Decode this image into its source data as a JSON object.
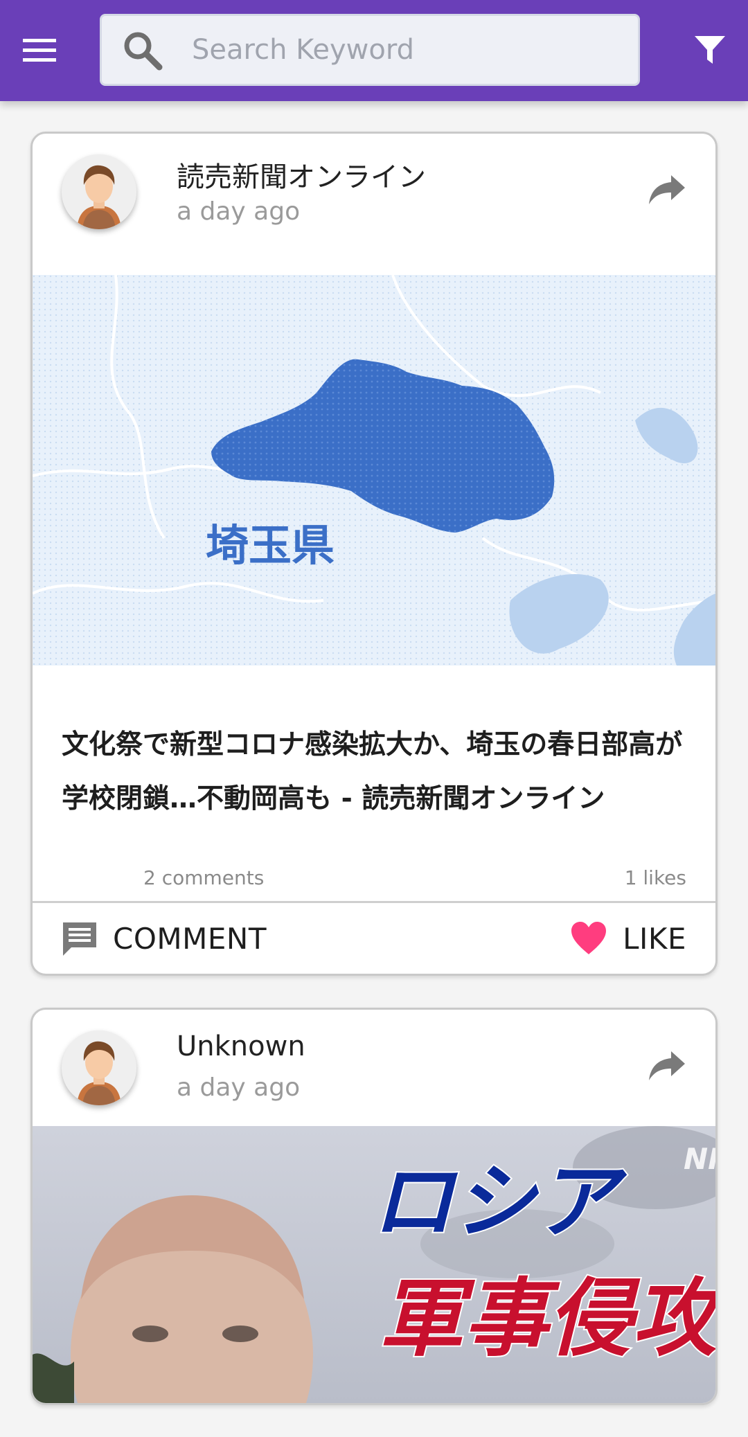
{
  "app_bar": {
    "search_placeholder": "Search Keyword",
    "icons": {
      "menu": "hamburger-menu-icon",
      "search": "search-icon",
      "filter": "filter-funnel-icon"
    },
    "colors": {
      "background": "#6a3fb8",
      "search_background": "#eef0f6"
    }
  },
  "posts": [
    {
      "author": "読売新聞オンライン",
      "time": "a day ago",
      "image_text": "埼玉県",
      "headline": "文化祭で新型コロナ感染拡大か、埼玉の春日部高が学校閉鎖…不動岡高も - 読売新聞オンライン",
      "comments_count": "2 comments",
      "likes_count": "1 likes",
      "comment_label": "COMMENT",
      "like_label": "LIKE"
    },
    {
      "author": "Unknown",
      "time": "a day ago",
      "image_text_top": "ロシア",
      "image_text_bottom": "軍事侵攻",
      "image_watermark": "NH"
    }
  ],
  "colors": {
    "like_heart": "#ff3d7f",
    "map_region": "#3b6fc7",
    "map_background": "#e8f1fb",
    "headline_red": "#c8102e",
    "headline_blue": "#0a2a9a"
  }
}
